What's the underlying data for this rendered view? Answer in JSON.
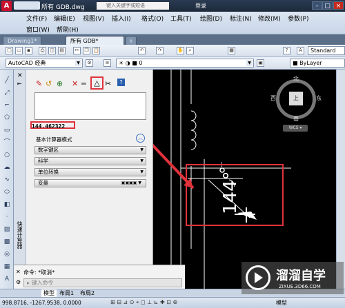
{
  "titlebar": {
    "doc_title": "所有 GDB.dwg",
    "search_placeholder": "键入关键字或短语",
    "signin_label": "登录"
  },
  "menu": {
    "items": [
      "文件(F)",
      "编辑(E)",
      "视图(V)",
      "插入(I)",
      "格式(O)",
      "工具(T)",
      "绘图(D)",
      "标注(N)",
      "修改(M)",
      "参数(P)"
    ],
    "items_row2": [
      "窗口(W)",
      "帮助(H)"
    ]
  },
  "tabs": [
    "Drawing1*",
    "所有 GDB*"
  ],
  "toolbar": {
    "workspace": "AutoCAD 经典",
    "layer_value": "0",
    "bylayer_label": "ByLayer",
    "style_label": "Standard"
  },
  "calculator": {
    "result_value": "144.462322",
    "basic_mode_label": "基本计算器模式",
    "sections": [
      "数字键区",
      "科学",
      "单位转换",
      "变量"
    ],
    "palette_title": "快速计算器"
  },
  "drawing": {
    "compass_n": "北",
    "compass_s": "南",
    "compass_e": "东",
    "compass_w": "西",
    "compass_center": "上",
    "wcs_label": "WCS",
    "dimension_text": "144°"
  },
  "command": {
    "line1": "命令: *取消*",
    "input_placeholder": "键入命令",
    "prefix": "命令:"
  },
  "layout_tabs": [
    "模型",
    "布局1",
    "布局2"
  ],
  "status": {
    "coords": "998.8716, -1267.9538, 0.0000",
    "model_label": "模型"
  },
  "watermark": {
    "brand": "溜溜自学",
    "url": "ZIXUE.3D66.COM"
  },
  "colors": {
    "highlight_red": "#e0323c",
    "crosshair": "#ffffff"
  }
}
